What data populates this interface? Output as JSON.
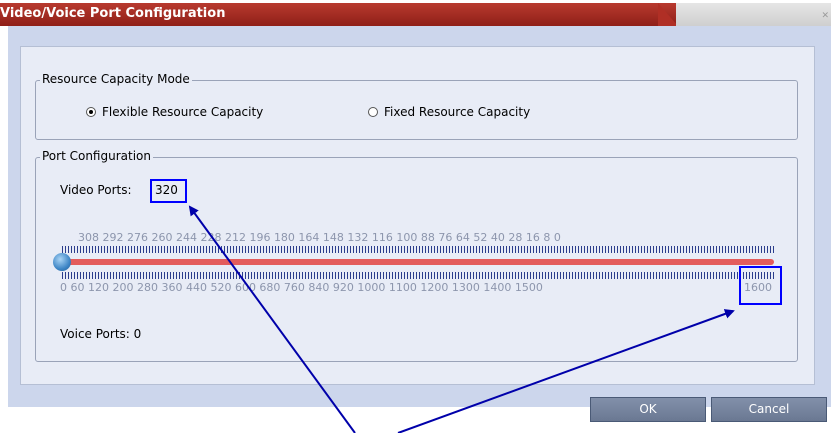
{
  "window": {
    "title": "Video/Voice Port Configuration",
    "close_icon": "close-icon"
  },
  "mode_group": {
    "legend": "Resource Capacity Mode",
    "options": [
      {
        "label": "Flexible Resource Capacity",
        "selected": true
      },
      {
        "label": "Fixed Resource Capacity",
        "selected": false
      }
    ]
  },
  "port_group": {
    "legend": "Port Configuration",
    "video_label": "Video Ports:",
    "video_value": "320",
    "voice_text": "Voice Ports: 0",
    "slider_top_labels": "308 292 276 260 244 228 212 196 180 164 148 132 116 100 88  76  64  52  40  28  16 8  0",
    "slider_bottom_labels": "0  60 120 200  280  360  440  520  600  680  760  840  920 1000  1100  1200  1300  1400  1500",
    "slider_max_label": "1600",
    "slider_position": 0
  },
  "buttons": {
    "ok": "OK",
    "cancel": "Cancel"
  },
  "colors": {
    "title_bar": "#a82c23",
    "highlight": "#0000ff",
    "slider_track": "#e35c5c"
  }
}
